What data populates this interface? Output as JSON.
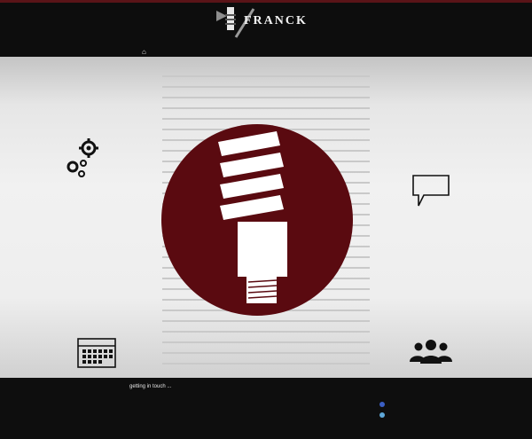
{
  "header": {
    "brand": "FRANCK",
    "nav_items": [
      "",
      "",
      "",
      "",
      "",
      "",
      ""
    ]
  },
  "colors": {
    "accent": "#5a0a10",
    "header_bg": "#0d0d0d",
    "page_bg": "#f1f1f1"
  },
  "icons": {
    "gears": "gears-icon",
    "speech": "speech-bubble-icon",
    "calendar": "calendar-icon",
    "users": "users-icon",
    "bulb": "light-bulb-icon"
  },
  "footer": {
    "title": "getting in touch ...",
    "left_items": [
      "",
      ""
    ],
    "right_items": [
      "",
      ""
    ]
  }
}
